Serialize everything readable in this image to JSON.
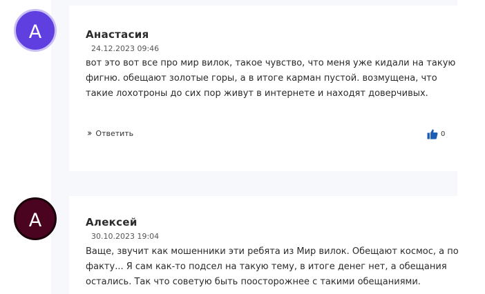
{
  "comments": [
    {
      "avatar_letter": "A",
      "avatar_color": "#5f3fe0",
      "author": "Анастасия",
      "date": "24.12.2023 09:46",
      "text": "вот это вот все про мир вилок, такое чувство, что меня уже кидали на такую фигню. обещают золотые горы, а в итоге карман пустой. возмущена, что такие лохотроны до сих пор живут в интернете и находят доверчивых.",
      "reply_label": "Ответить",
      "likes": "0"
    },
    {
      "avatar_letter": "A",
      "avatar_color": "#4a0420",
      "author": "Алексей",
      "date": "30.10.2023 19:04",
      "text": "Ваще, звучит как мошенники эти ребята из Мир вилок. Обещают космос, а по факту... Я сам как-то подсел на такую тему, в итоге денег нет, а обещания остались. Так что советую быть поосторожнее с такими обещаниями."
    }
  ],
  "icons": {
    "reply": "double-chevron-right-icon",
    "like": "thumbs-up-icon"
  },
  "colors": {
    "like_icon": "#1e5db5"
  }
}
